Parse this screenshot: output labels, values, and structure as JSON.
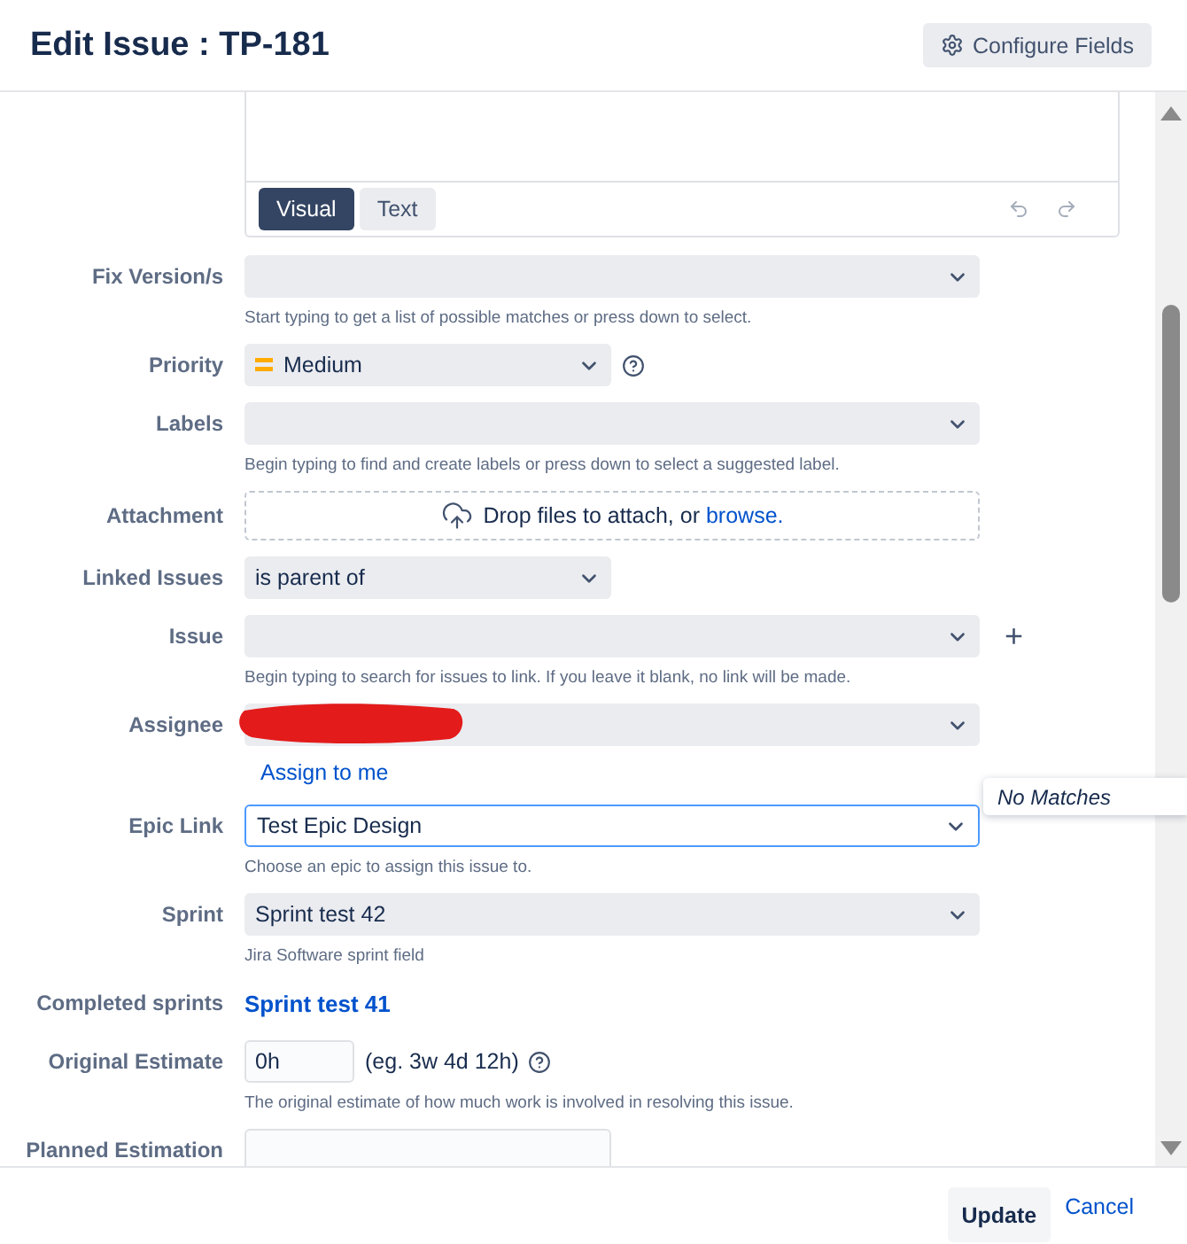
{
  "dialog": {
    "title": "Edit Issue : TP-181",
    "configure_button": "Configure Fields"
  },
  "editor": {
    "tabs": [
      {
        "label": "Visual",
        "selected": true
      },
      {
        "label": "Text",
        "selected": false
      }
    ]
  },
  "fields": [
    {
      "kind": "select",
      "label": "Fix Version/s",
      "hint": "Start typing to get a list of possible matches or press down to select."
    },
    {
      "kind": "short-select",
      "label": "Priority",
      "value": "Medium",
      "priority_icon": true,
      "help": true
    },
    {
      "kind": "select",
      "label": "Labels",
      "hint": "Begin typing to find and create labels or press down to select a suggested label."
    },
    {
      "kind": "attachment",
      "label": "Attachment",
      "text": "Drop files to attach, or",
      "link": "browse."
    },
    {
      "kind": "short-select",
      "label": "Linked Issues",
      "value": "is parent of"
    },
    {
      "kind": "select",
      "label": "Issue",
      "add": "+",
      "hint": "Begin typing to search for issues to link. If you leave it blank, no link will be made."
    },
    {
      "kind": "select",
      "label": "Assignee",
      "redacted": true,
      "link": "Assign to me"
    },
    {
      "kind": "select",
      "label": "Epic Link",
      "value": "Test Epic Design",
      "focused": true,
      "hint": "Choose an epic to assign this issue to."
    },
    {
      "kind": "select",
      "label": "Sprint",
      "value": "Sprint test 42",
      "hint": "Jira Software sprint field"
    },
    {
      "kind": "linkvalue",
      "label": "Completed sprints",
      "value": "Sprint test 41"
    },
    {
      "kind": "estimate",
      "label": "Original Estimate",
      "value": "0h",
      "note": "(eg. 3w 4d 12h)",
      "help": true,
      "hint": "The original estimate of how much work is involved in resolving this issue."
    },
    {
      "kind": "input",
      "label": "Planned Estimation"
    }
  ],
  "popover": {
    "text": "No Matches"
  },
  "footer": {
    "submit": "Update",
    "cancel": "Cancel"
  }
}
